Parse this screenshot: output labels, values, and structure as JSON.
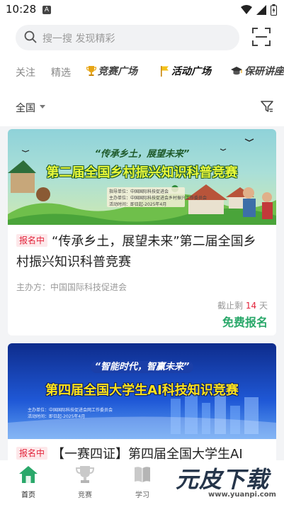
{
  "status_bar": {
    "time": "10:28",
    "notif_badge": "A"
  },
  "search": {
    "placeholder": "搜一搜 发现精彩"
  },
  "tabs": [
    {
      "label": "关注"
    },
    {
      "label": "精选"
    },
    {
      "label": "竞赛广场",
      "icon": "trophy-icon"
    },
    {
      "label": "活动广场",
      "icon": "flag-icon"
    },
    {
      "label": "保研讲座",
      "icon": "graduation-cap-icon"
    }
  ],
  "filter": {
    "region": "全国"
  },
  "cards": [
    {
      "banner": {
        "slogan": "“传承乡土，展望未来”",
        "title": "第二届全国乡村振兴知识科普竞赛",
        "info": [
          "指导单位：中国国际科技促进会",
          "主办单位：中国国际科技促进会乡村振兴工作委员会",
          "活动时间：即日起-2025年4月"
        ]
      },
      "status": "报名中",
      "title": "“传承乡土，展望未来”第二届全国乡村振兴知识科普竞赛",
      "organizer": "主办方：中国国际科技促进会",
      "deadline_prefix": "截止剩",
      "deadline_days": "14",
      "deadline_suffix": "天",
      "action": "免费报名"
    },
    {
      "banner": {
        "slogan": "“智能时代，智赢未来”",
        "title": "第四届全国大学生AI科技知识竞赛",
        "info": [
          "主办单位：中国国际科技促进会网工作委员会",
          "活动时间：即日起-2025年4月"
        ]
      },
      "status": "报名中",
      "title": "【一赛四证】第四届全国大学生AI"
    }
  ],
  "bottom_nav": [
    {
      "label": "首页",
      "icon": "home-icon",
      "active": true
    },
    {
      "label": "竞赛",
      "icon": "trophy-icon"
    },
    {
      "label": "学习",
      "icon": "book-icon"
    }
  ],
  "watermark": {
    "text": "元皮下载",
    "url": "www.yuanpi.com"
  },
  "colors": {
    "accent_green": "#2aa86a",
    "badge_red": "#e2233a",
    "badge_bg": "#fde8ea"
  }
}
